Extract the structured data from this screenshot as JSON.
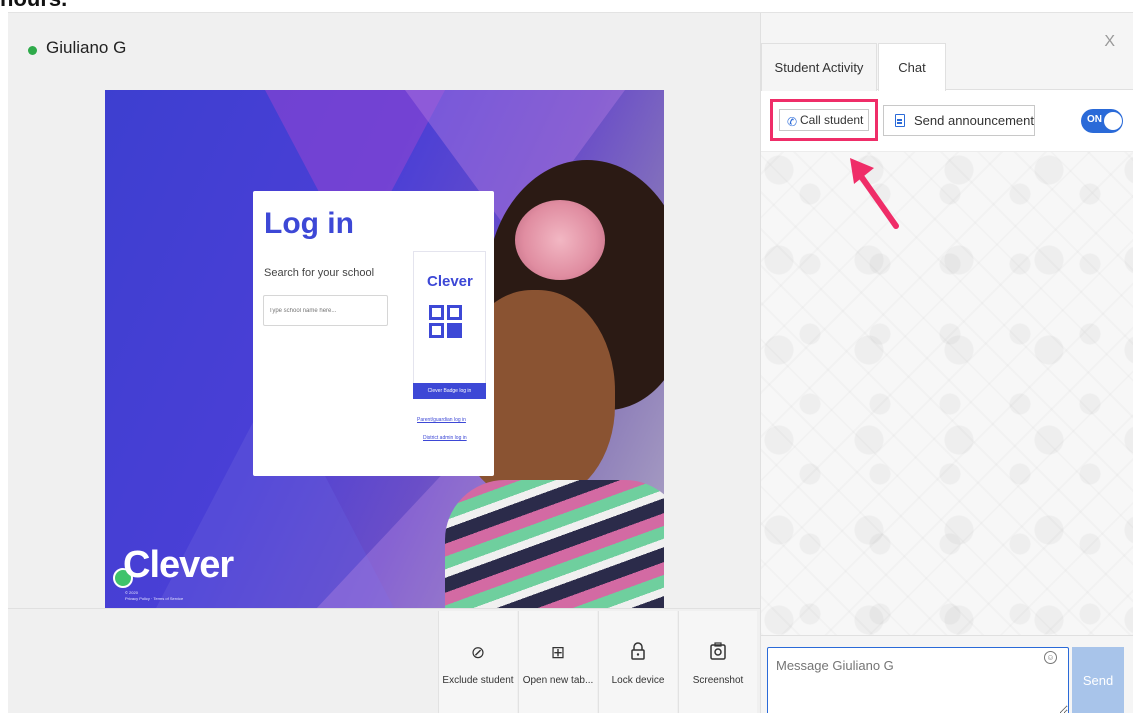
{
  "page": {
    "header_fragment": "hours."
  },
  "student": {
    "name": "Giuliano G",
    "status_color": "#2eaa4a"
  },
  "screen": {
    "login_title": "Log in",
    "search_label": "Search for your school",
    "search_placeholder": "Type school name here...",
    "side_logo": "Clever",
    "badge_button": "Clever Badge log in",
    "parent_link": "Parent/guardian log in",
    "district_link": "District admin log in",
    "big_logo": "Clever",
    "fine_print_1": "© 2020",
    "fine_print_2": "Privacy Policy · Terms of Service"
  },
  "toolbar": {
    "tools": [
      {
        "label": "Exclude student",
        "icon": "block-icon"
      },
      {
        "label": "Open new tab...",
        "icon": "new-tab-icon"
      },
      {
        "label": "Lock device",
        "icon": "lock-icon"
      },
      {
        "label": "Screenshot",
        "icon": "camera-icon"
      }
    ]
  },
  "panel": {
    "tabs": [
      {
        "label": "Student Activity",
        "active": false
      },
      {
        "label": "Chat",
        "active": true
      }
    ],
    "close_label": "X",
    "call_label": "Call student",
    "announcement_label": "Send announcement",
    "toggle_label": "ON",
    "toggle_on": true,
    "message_placeholder": "Message Giuliano G",
    "send_label": "Send"
  },
  "colors": {
    "accent": "#2a6ad8",
    "highlight": "#ef2d68",
    "clever_blue": "#3d48d6"
  }
}
